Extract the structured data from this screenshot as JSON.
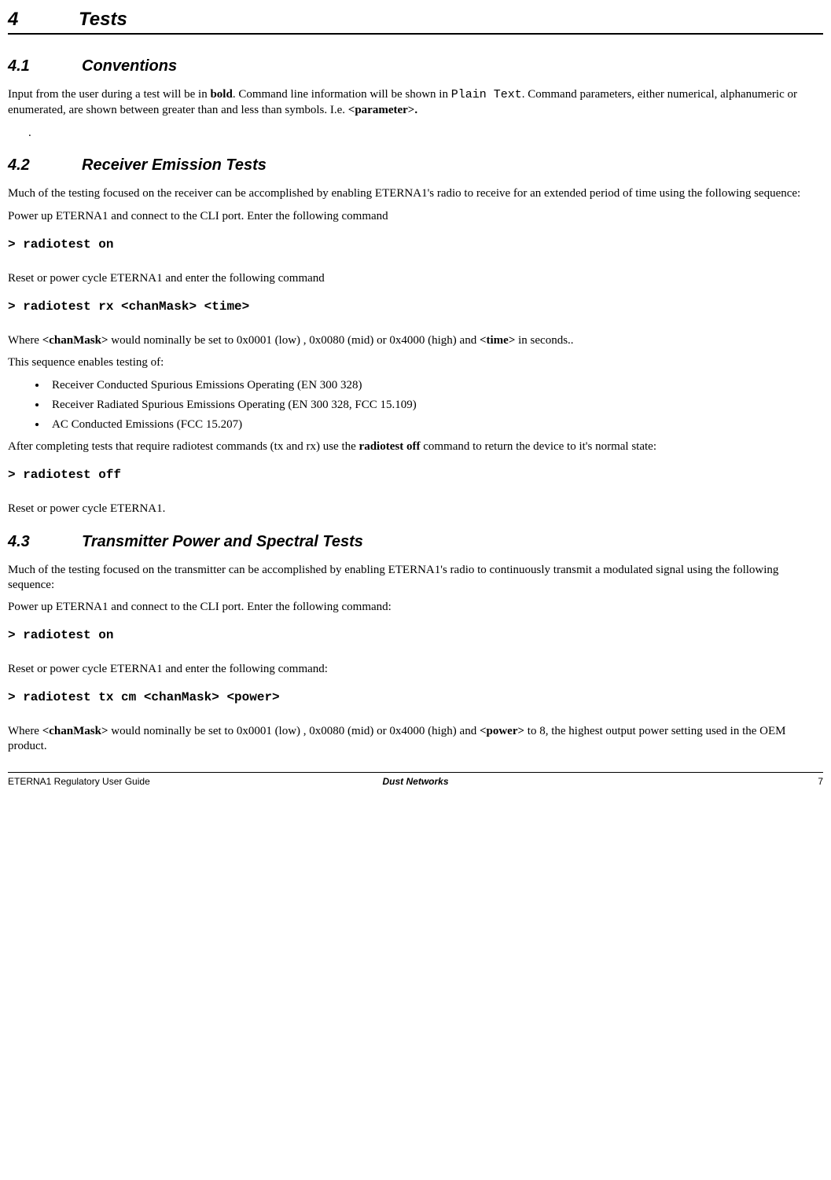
{
  "h1": {
    "num": "4",
    "title": "Tests"
  },
  "s41": {
    "num": "4.1",
    "title": "Conventions",
    "p1a": "Input from the user during a test will be in ",
    "p1b": "bold",
    "p1c": ".  Command line information will be shown in ",
    "p1d": "Plain Text",
    "p1e": ".   Command parameters, either numerical, alphanumeric or enumerated, are shown between greater than and less than symbols.  I.e. ",
    "p1f": "<parameter>.",
    "dot": "."
  },
  "s42": {
    "num": "4.2",
    "title": "Receiver Emission Tests",
    "p1": "Much of the testing focused on the receiver can be accomplished by enabling ETERNA1's radio to receive for an extended period of time using the following sequence:",
    "p2": "Power up ETERNA1 and connect to the CLI port.  Enter the following command",
    "cmd1": "> radiotest on",
    "p3": "Reset or power cycle ETERNA1 and enter the following command",
    "cmd2": "> radiotest rx <chanMask> <time>",
    "p4a": "Where ",
    "p4b": "<chanMask>",
    "p4c": " would nominally be set to 0x0001 (low) , 0x0080 (mid) or 0x4000 (high) and ",
    "p4d": "<time>",
    "p4e": " in seconds..",
    "p5": "This sequence enables testing of:",
    "bullets": [
      "Receiver Conducted Spurious Emissions Operating (EN 300 328)",
      "Receiver Radiated Spurious Emissions Operating (EN 300 328, FCC 15.109)",
      "AC Conducted Emissions (FCC 15.207)"
    ],
    "p6a": "After completing tests that require radiotest commands (tx and rx) use the ",
    "p6b": "radiotest off",
    "p6c": " command to return the device to it's normal state:",
    "cmd3": "> radiotest off",
    "p7": "Reset or power cycle ETERNA1."
  },
  "s43": {
    "num": "4.3",
    "title": "Transmitter Power and Spectral Tests",
    "p1": "Much of the testing focused on the transmitter can be accomplished by enabling ETERNA1's radio to continuously transmit a modulated signal using the following sequence:",
    "p2": "Power up ETERNA1 and connect to the CLI port.  Enter the following command:",
    "cmd1": "> radiotest on",
    "p3": "Reset or power cycle ETERNA1 and enter the following command:",
    "cmd2": "> radiotest tx cm <chanMask> <power>",
    "p4a": "Where ",
    "p4b": "<chanMask>",
    "p4c": " would nominally be set to 0x0001 (low) , 0x0080 (mid) or 0x4000 (high) and ",
    "p4d": "<power>",
    "p4e": " to 8, the highest output power setting used in the OEM product."
  },
  "footer": {
    "left": "ETERNA1 Regulatory User Guide",
    "center": "Dust Networks",
    "right": "7"
  }
}
